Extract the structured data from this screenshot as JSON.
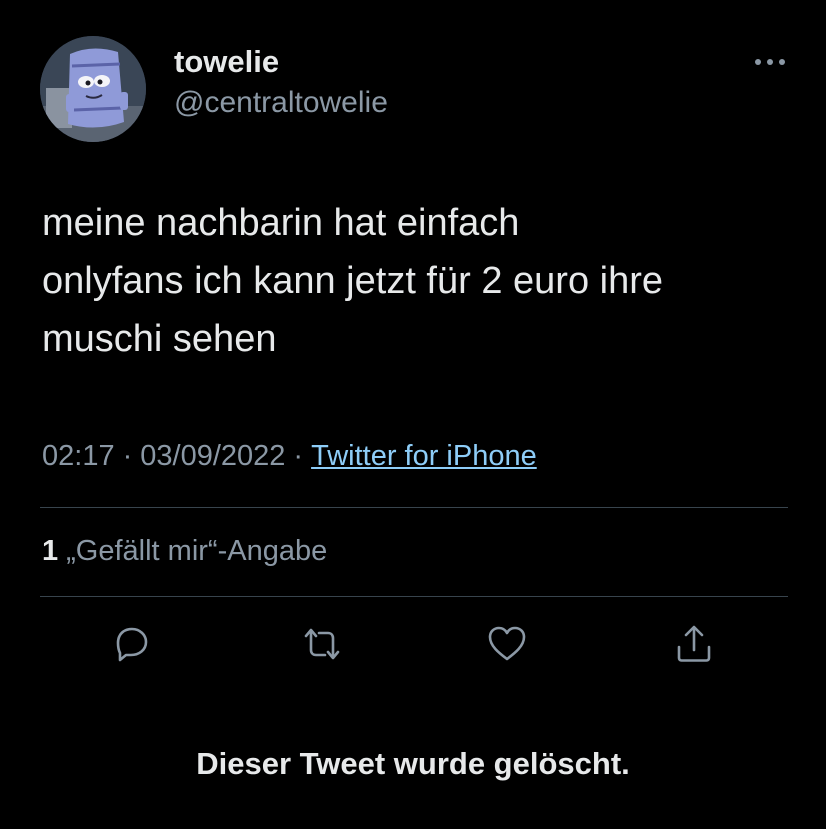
{
  "user": {
    "display_name": "towelie",
    "handle": "@centraltowelie",
    "avatar_icon": "towelie-avatar"
  },
  "tweet": {
    "text": "meine nachbarin hat einfach\nonlyfans ich kann jetzt für 2 euro ihre\nmuschi sehen",
    "time": "02:17",
    "separator": "·",
    "date": "03/09/2022",
    "source": "Twitter for iPhone"
  },
  "stats": {
    "like_count": "1",
    "like_label": "„Gefällt mir“-Angabe"
  },
  "actions": {
    "reply_icon": "reply-icon",
    "retweet_icon": "retweet-icon",
    "like_icon": "heart-icon",
    "share_icon": "share-icon",
    "more_icon": "more-icon"
  },
  "notice": {
    "deleted_text": "Dieser Tweet wurde gelöscht."
  },
  "colors": {
    "background": "#000000",
    "primary_text": "#e7e9ea",
    "secondary_text": "#8b98a5",
    "link": "#8ecdf8",
    "divider": "#38444d"
  }
}
